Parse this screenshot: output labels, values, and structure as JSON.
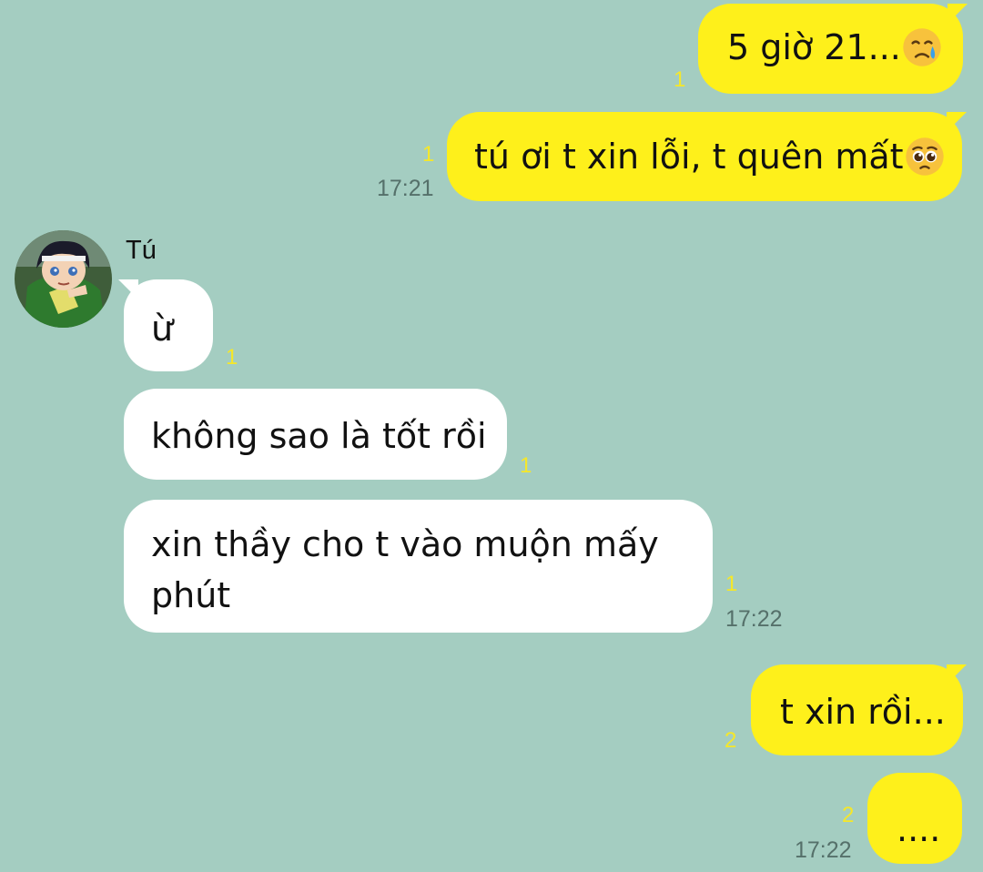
{
  "chat": {
    "contact_name": "Tú",
    "messages": [
      {
        "side": "out",
        "text": "5 giờ 21...",
        "emoji": "crying-face-emoji",
        "unread": "1",
        "time": ""
      },
      {
        "side": "out",
        "text": "tú ơi t xin lỗi, t quên mất",
        "emoji": "pleading-face-emoji",
        "unread": "1",
        "time": "17:21"
      },
      {
        "side": "in",
        "text": "ừ",
        "unread": "1",
        "time": ""
      },
      {
        "side": "in",
        "text": "không sao là tốt rồi",
        "unread": "1",
        "time": ""
      },
      {
        "side": "in",
        "text_line1": "xin thầy cho t vào muộn mấy",
        "text_line2": "phút",
        "unread": "1",
        "time": "17:22"
      },
      {
        "side": "out",
        "text": "t xin rồi...",
        "unread": "2",
        "time": ""
      },
      {
        "side": "out",
        "text": "....",
        "unread": "2",
        "time": "17:22"
      }
    ]
  },
  "colors": {
    "background": "#a4cdc1",
    "outgoing_bubble": "#fef01b",
    "incoming_bubble": "#ffffff",
    "unread_count": "#f5e72a",
    "timestamp": "#55706a"
  }
}
